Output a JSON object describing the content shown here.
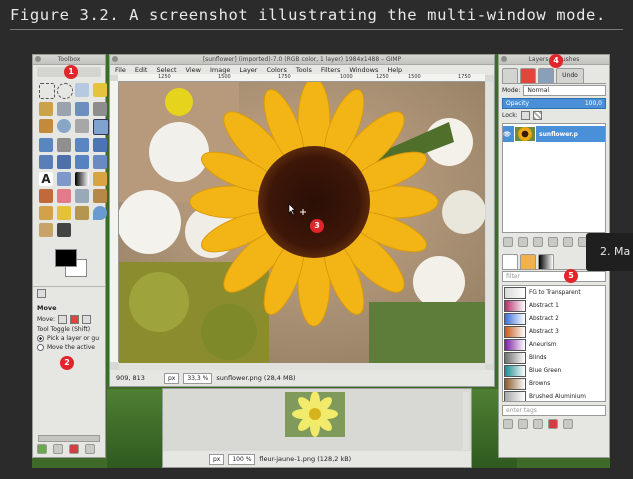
{
  "caption": "Figure 3.2.  A screenshot illustrating the multi-window mode.",
  "badges": [
    "1",
    "2",
    "3",
    "4",
    "5"
  ],
  "toolbox": {
    "title": "Toolbox",
    "options_title": "Move",
    "move_label": "Move:",
    "tool_toggle": "Tool Toggle  (Shift)",
    "radio1": "Pick a layer or gu",
    "radio2": "Move the active"
  },
  "image_window": {
    "title": "[sunflower] (imported)-7.0 (RGB color, 1 layer) 1984x1488 – GIMP",
    "menu": [
      "File",
      "Edit",
      "Select",
      "View",
      "Image",
      "Layer",
      "Colors",
      "Tools",
      "Filters",
      "Windows",
      "Help"
    ],
    "ruler_ticks": [
      "1250",
      "1500",
      "1750",
      "1000",
      "1250",
      "1500",
      "1750"
    ],
    "coords": "909, 813",
    "unit": "px",
    "zoom": "33,3 %",
    "status": "sunflower.png (28,4 MB)"
  },
  "image_window2": {
    "unit": "px",
    "zoom": "100 %",
    "status": "fleur-jaune-1.png (128,2 kB)"
  },
  "dock": {
    "title": "Layers – Brushes",
    "undo_tab": "Undo",
    "mode_label": "Mode:",
    "mode_value": "Normal",
    "opacity_label": "Opacity",
    "opacity_value": "100,0",
    "lock_label": "Lock:",
    "layer_name": "sunflower.p",
    "filter_label": "filter",
    "tag_placeholder": "enter tags",
    "gradients": [
      {
        "name": "FG to Transparent",
        "color": "#d9d9d9"
      },
      {
        "name": "Abstract 1",
        "color": "#b0306a"
      },
      {
        "name": "Abstract 2",
        "color": "#3a6fd8"
      },
      {
        "name": "Abstract 3",
        "color": "#c35a1c"
      },
      {
        "name": "Aneurism",
        "color": "#7a1fa0"
      },
      {
        "name": "Blinds",
        "color": "#6e6e6e"
      },
      {
        "name": "Blue Green",
        "color": "#1d8a8f"
      },
      {
        "name": "Browns",
        "color": "#8a5a2a"
      },
      {
        "name": "Brushed Aluminium",
        "color": "#a8a8a8"
      }
    ]
  },
  "tooltip": "2. Ma",
  "colors": {
    "accent": "#4a90d9",
    "badge": "#e0252b"
  }
}
